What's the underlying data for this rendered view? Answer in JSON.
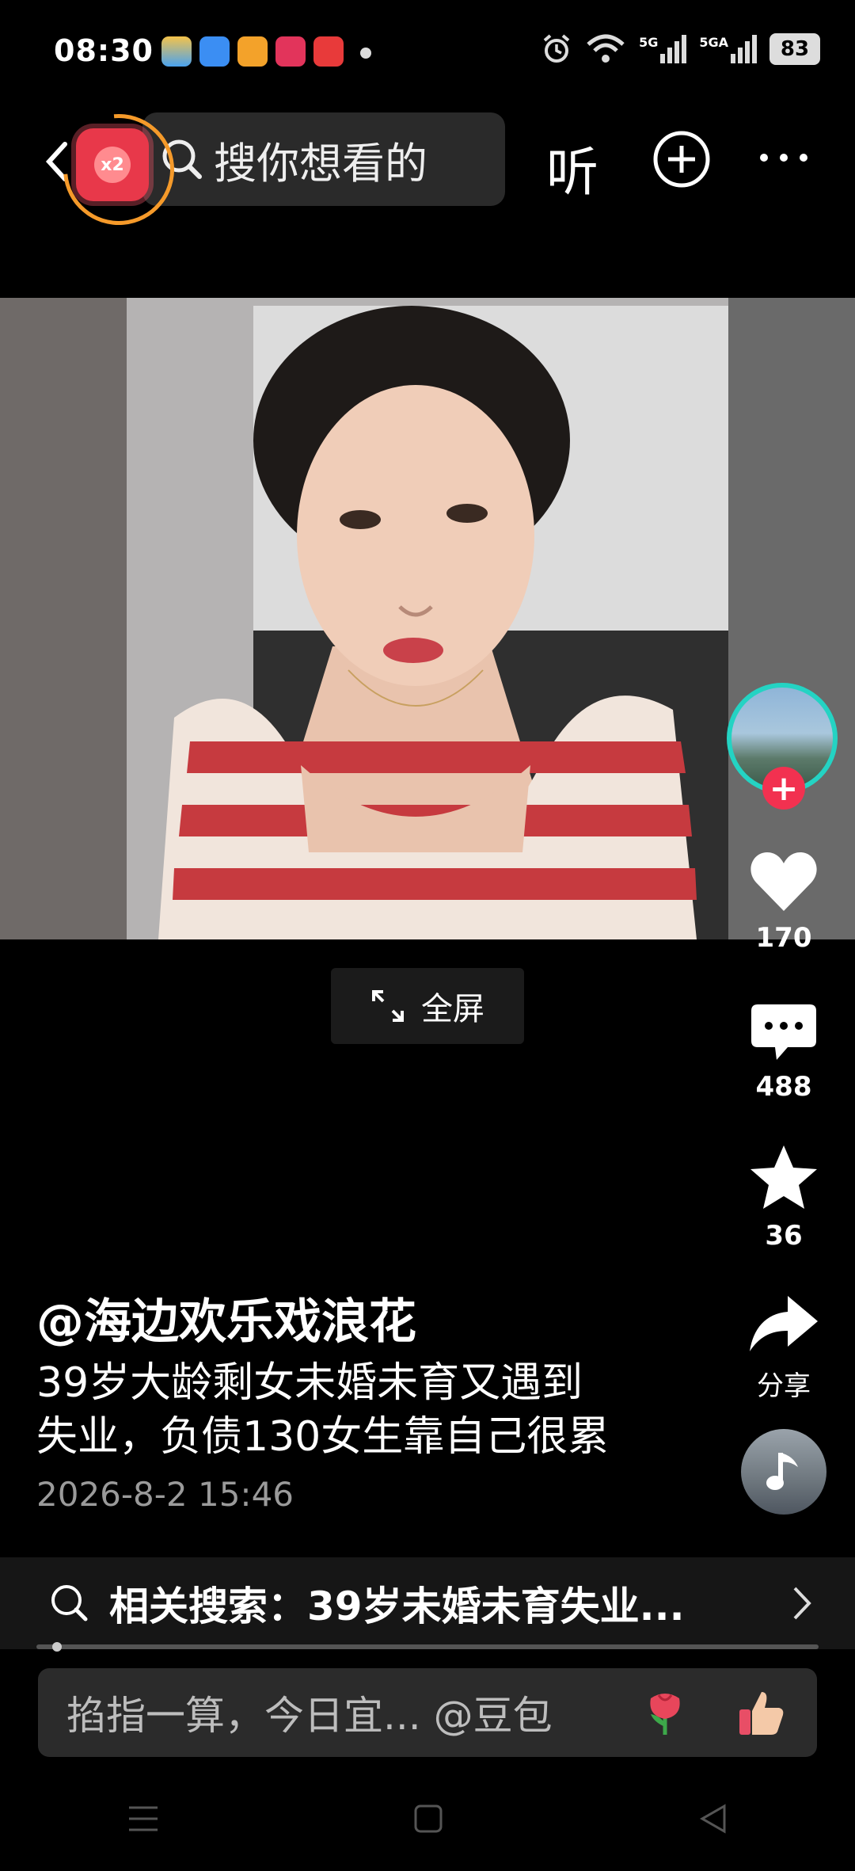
{
  "status_bar": {
    "time": "08:30",
    "battery": "83",
    "network": [
      "5G",
      "5GA"
    ]
  },
  "top_bar": {
    "badge": "x2",
    "search_placeholder": "搜你想看的",
    "listen_label": "听"
  },
  "video": {
    "fullscreen_label": "全屏"
  },
  "side_actions": {
    "likes": "170",
    "comments": "488",
    "favorites": "36",
    "share_label": "分享"
  },
  "post": {
    "author": "@海边欢乐戏浪花",
    "description_line1": "39岁大龄剩女未婚未育又遇到",
    "description_line2": "失业，负债130女生靠自己很累",
    "date": "2026-8-2 15:46"
  },
  "related_search": {
    "text": "相关搜索：39岁未婚未育失业..."
  },
  "progress": 0.02,
  "input_bar": {
    "placeholder": "掐指一算，今日宜... @豆包"
  },
  "colors": {
    "accent_red": "#f23150",
    "ring_orange": "#f59a2a",
    "avatar_ring": "#24d3c3"
  }
}
